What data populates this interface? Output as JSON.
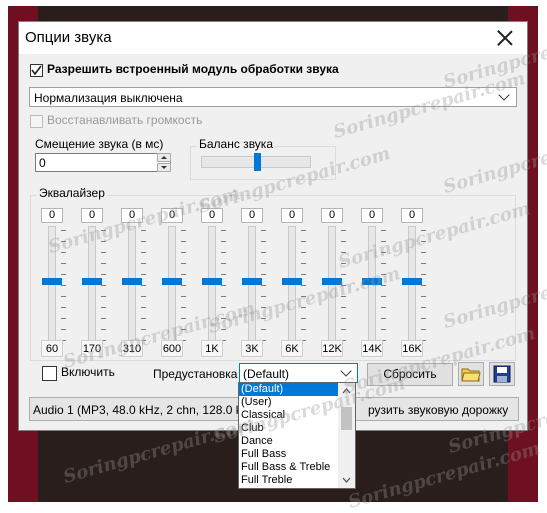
{
  "dialog": {
    "title": "Опции звука",
    "enable_module_label": "Разрешить встроенный модуль обработки звука",
    "normalization_value": "Нормализация выключена",
    "restore_volume_label": "Восстанавливать громкость",
    "offset": {
      "label": "Смещение звука (в мс)",
      "value": "0"
    },
    "balance": {
      "label": "Баланс звука",
      "level": 0.5
    },
    "equalizer": {
      "label": "Эквалайзер",
      "bands": [
        {
          "freq": "60",
          "value": "0"
        },
        {
          "freq": "170",
          "value": "0"
        },
        {
          "freq": "310",
          "value": "0"
        },
        {
          "freq": "600",
          "value": "0"
        },
        {
          "freq": "1K",
          "value": "0"
        },
        {
          "freq": "3K",
          "value": "0"
        },
        {
          "freq": "6K",
          "value": "0"
        },
        {
          "freq": "12K",
          "value": "0"
        },
        {
          "freq": "14K",
          "value": "0"
        },
        {
          "freq": "16K",
          "value": "0"
        }
      ],
      "enable_label": "Включить",
      "preset_label": "Предустановка",
      "preset_value": "(Default)",
      "reset_label": "Сбросить"
    },
    "audio_track_value": "Audio 1 (MP3, 48.0 kHz, 2 chn, 128.0 kbit",
    "load_track_label": "рузить звуковую дорожку"
  },
  "preset_dropdown": {
    "options": [
      "(Default)",
      "(User)",
      "Classical",
      "Club",
      "Dance",
      "Full Bass",
      "Full Bass & Treble",
      "Full Treble"
    ],
    "selected": "(Default)"
  },
  "watermark": "Soringpcrepair.com",
  "colors": {
    "accent": "#0078d7"
  }
}
